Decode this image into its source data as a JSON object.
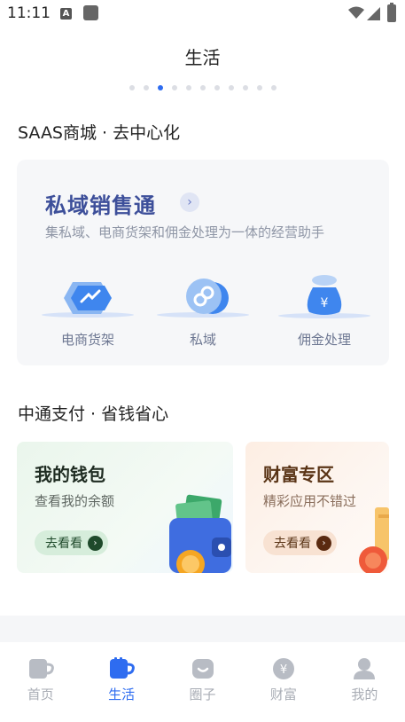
{
  "status_bar": {
    "time": "11:11",
    "a_badge": "A"
  },
  "page": {
    "title": "生活"
  },
  "carousel": {
    "count": 11,
    "active_index": 2
  },
  "section1": {
    "title": "SAAS商城 · 去中心化",
    "card": {
      "title": "私域销售通",
      "arrow": "›",
      "subtitle": "集私域、电商货架和佣金处理为一体的经营助手",
      "features": [
        {
          "label": "电商货架",
          "icon": "storefront-hexagon-icon"
        },
        {
          "label": "私域",
          "icon": "link-chain-icon"
        },
        {
          "label": "佣金处理",
          "icon": "money-bag-icon"
        }
      ]
    }
  },
  "section2": {
    "title": "中通支付 · 省钱省心",
    "wallet": {
      "title": "我的钱包",
      "subtitle": "查看我的余额",
      "button": "去看看",
      "arrow": "›"
    },
    "wealth": {
      "title": "财富专区",
      "subtitle": "精彩应用不错过",
      "button": "去看看",
      "arrow": "›"
    }
  },
  "tabs": [
    {
      "label": "首页",
      "icon": "home-cup-icon",
      "active": false
    },
    {
      "label": "生活",
      "icon": "life-cup-icon",
      "active": true
    },
    {
      "label": "圈子",
      "icon": "circle-chat-icon",
      "active": false
    },
    {
      "label": "财富",
      "icon": "yuan-coin-icon",
      "active": false
    },
    {
      "label": "我的",
      "icon": "user-icon",
      "active": false
    }
  ],
  "colors": {
    "accent": "#2e6cf0",
    "inactive": "#a9adb5",
    "promo_title": "#3d4f9a"
  }
}
